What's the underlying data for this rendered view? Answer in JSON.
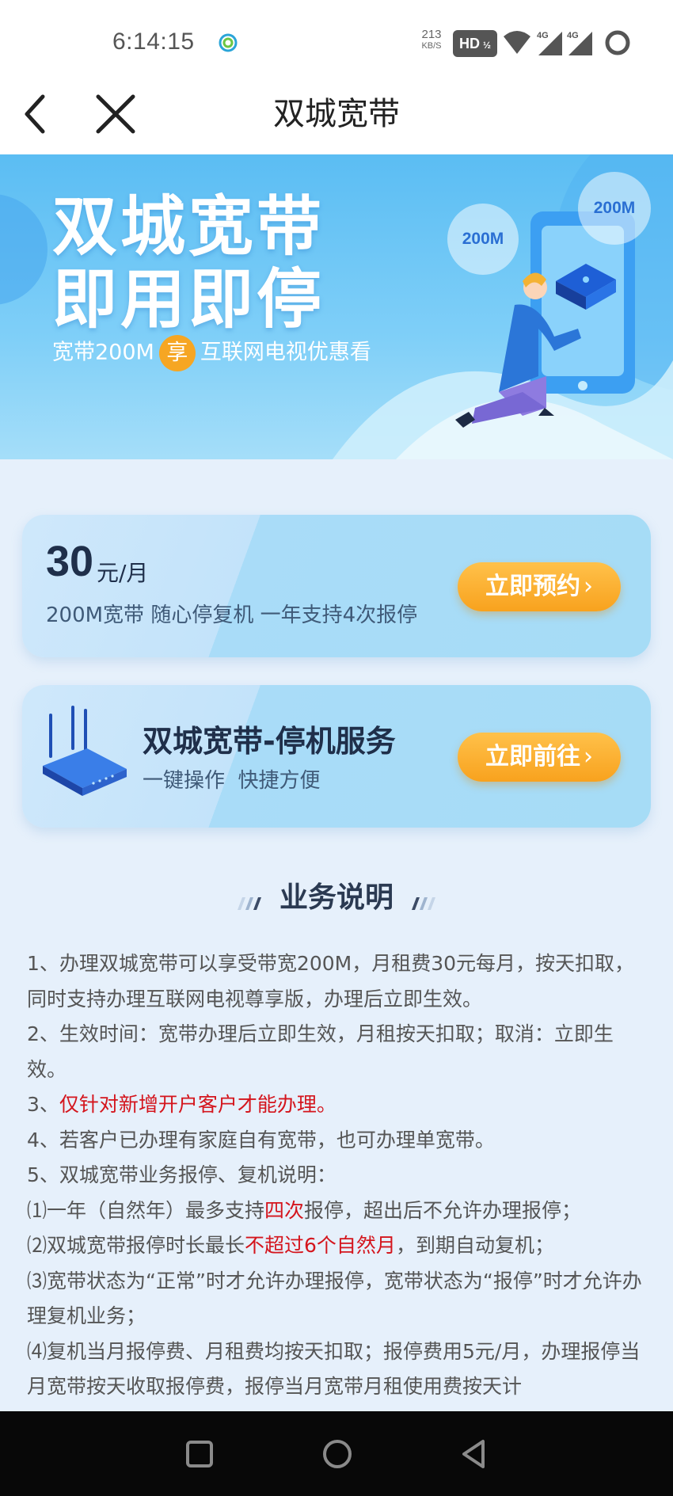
{
  "status_bar": {
    "time": "6:14:15",
    "speed_value": "213",
    "speed_unit": "KB/S",
    "hd_label": "HD",
    "network_1": "4G",
    "network_2": "4G"
  },
  "header": {
    "title": "双城宽带"
  },
  "banner": {
    "title_line1": "双城宽带",
    "title_line2": "即用即停",
    "sub_before": "宽带200M",
    "sub_badge": "享",
    "sub_after": "互联网电视优惠看",
    "bubble_1": "200M",
    "bubble_2": "200M"
  },
  "plan_card": {
    "price": "30",
    "unit": "元/月",
    "description": "200M宽带 随心停复机 一年支持4次报停",
    "button_label": "立即预约",
    "button_chevron": "›"
  },
  "service_card": {
    "title": "双城宽带-停机服务",
    "subtitle": "一键操作  快捷方便",
    "button_label": "立即前往",
    "button_chevron": "›"
  },
  "section": {
    "title": "业务说明"
  },
  "rules": {
    "r1": "1、办理双城宽带可以享受带宽200M，月租费30元每月，按天扣取，同时支持办理互联网电视尊享版，办理后立即生效。",
    "r2": "2、生效时间：宽带办理后立即生效，月租按天扣取；取消：立即生效。",
    "r3_prefix": "3、",
    "r3_red": "仅针对新增开户客户才能办理。",
    "r4": "4、若客户已办理有家庭自有宽带，也可办理单宽带。",
    "r5": "5、双城宽带业务报停、复机说明：",
    "r6_before": "⑴一年（自然年）最多支持",
    "r6_red": "四次",
    "r6_after": "报停，超出后不允许办理报停；",
    "r7_before": "⑵双城宽带报停时长最长",
    "r7_red": "不超过6个自然月",
    "r7_after": "，到期自动复机；",
    "r8": "⑶宽带状态为“正常”时才允许办理报停，宽带状态为“报停”时才允许办理复机业务；",
    "r9": "⑷复机当月报停费、月租费均按天扣取；报停费用5元/月，办理报停当月宽带按天收取报停费，报停当月宽带月租使用费按天计"
  },
  "colors": {
    "accent_orange": "#f8a21e",
    "highlight_red": "#d4151d",
    "banner_blue": "#5bbdf3"
  }
}
